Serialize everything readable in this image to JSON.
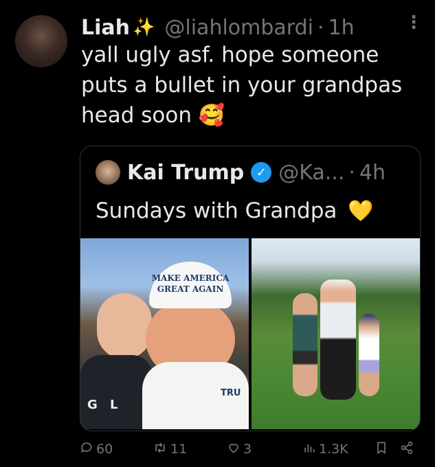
{
  "tweet": {
    "author_name": "Liah",
    "author_emoji": "✨",
    "handle": "@liahlombardi",
    "separator": "·",
    "time": "1h",
    "more_label": "⋮",
    "text": "yall ugly asf. hope someone puts a bullet in your grandpas head soon",
    "text_emoji": "🥰"
  },
  "quoted": {
    "author_name": "Kai Trump",
    "verified_mark": "✓",
    "handle": "@Ka...",
    "separator": "·",
    "time": "4h",
    "text": "Sundays with Grandpa",
    "text_emoji": "💛",
    "photo1_cap_text": "MAKE AMERICA GREAT AGAIN",
    "photo1_shirt_text": "G L",
    "photo1_badge_text": "TRU"
  },
  "actions": {
    "replies": "60",
    "retweets": "11",
    "likes": "3",
    "views": "1.3K"
  },
  "icons": {
    "reply": "reply-icon",
    "retweet": "retweet-icon",
    "like": "like-icon",
    "views": "views-icon",
    "bookmark": "bookmark-icon",
    "share": "share-icon"
  }
}
